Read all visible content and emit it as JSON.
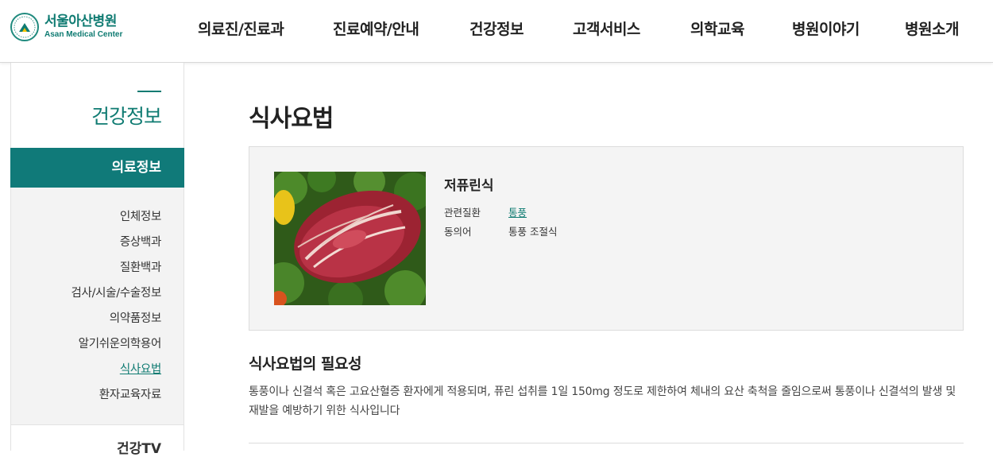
{
  "header": {
    "logo": {
      "name_ko": "서울아산병원",
      "name_en": "Asan Medical Center",
      "emblem_text": "ASAN FOUNDATION"
    },
    "nav": [
      {
        "label": "의료진/진료과"
      },
      {
        "label": "진료예약/안내"
      },
      {
        "label": "건강정보"
      },
      {
        "label": "고객서비스"
      },
      {
        "label": "의학교육"
      },
      {
        "label": "병원이야기"
      },
      {
        "label": "병원소개"
      }
    ]
  },
  "sidebar": {
    "title": "건강정보",
    "active_section": "의료정보",
    "items": [
      {
        "label": "인체정보"
      },
      {
        "label": "증상백과"
      },
      {
        "label": "질환백과"
      },
      {
        "label": "검사/시술/수술정보"
      },
      {
        "label": "의약품정보"
      },
      {
        "label": "알기쉬운의학용어"
      },
      {
        "label": "식사요법"
      },
      {
        "label": "환자교육자료"
      }
    ],
    "next_section": "건강TV"
  },
  "main": {
    "page_title": "식사요법",
    "diet": {
      "name": "저퓨린식",
      "related_label": "관련질환",
      "related_value": "통풍",
      "synonym_label": "동의어",
      "synonym_value": "통풍 조절식"
    },
    "section": {
      "title": "식사요법의 필요성",
      "body": "통풍이나 신결석 혹은 고요산혈증 환자에게 적용되며, 퓨린 섭취를 1일 150mg 정도로 제한하여 체내의 요산 축척을 줄임으로써 통풍이나 신결석의 발생 및 재발을 예방하기 위한 식사입니다"
    }
  },
  "colors": {
    "brand": "#0f7b72",
    "sidebar_active_bg": "#107a79",
    "sidebar_bg": "#f3f3f3",
    "box_bg": "#f4f4f4"
  }
}
